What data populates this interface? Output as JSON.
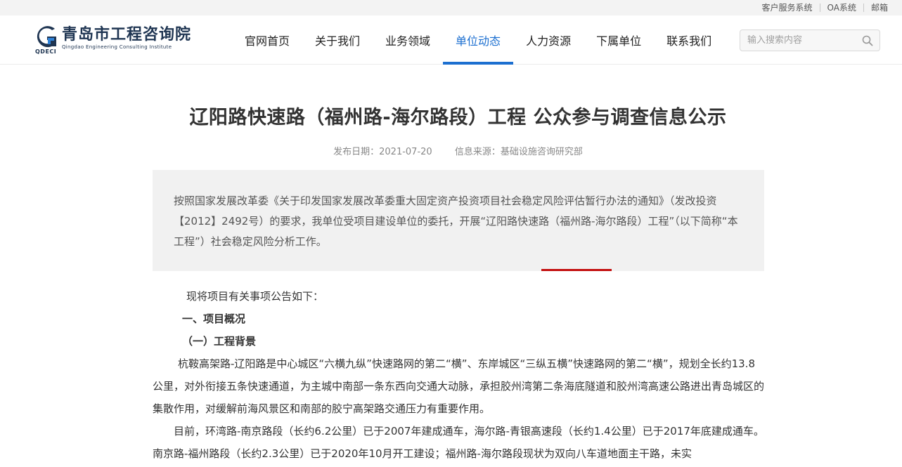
{
  "topbar": {
    "links": [
      "客户服务系统",
      "OA系统",
      "邮箱"
    ]
  },
  "logo": {
    "cn": "青岛市工程咨询院",
    "en": "Qingdao Engineering Consulting Institute",
    "abbr": "QDECI"
  },
  "nav": {
    "items": [
      "官网首页",
      "关于我们",
      "业务领域",
      "单位动态",
      "人力资源",
      "下属单位",
      "联系我们"
    ],
    "active": "单位动态"
  },
  "search": {
    "placeholder": "输入搜索内容",
    "icon": "search-icon"
  },
  "article": {
    "title": "辽阳路快速路（福州路-海尔路段）工程 公众参与调查信息公示",
    "date": "发布日期：2021-07-20",
    "source": "信息来源：基础设施咨询研究部",
    "summary": "按照国家发展改革委《关于印发国家发展改革委重大固定资产投资项目社会稳定风险评估暂行办法的通知》（发改投资【2012】2492号）的要求，我单位受项目建设单位的委托，开展“辽阳路快速路（福州路-海尔路段）工程”（以下简称“本工程”）社会稳定风险分析工作。",
    "intro": "现将项目有关事项公告如下：",
    "heading1": "一、项目概况",
    "heading2": "（一）工程背景",
    "para1": "杭鞍高架路-辽阳路是中心城区“六横九纵”快速路网的第二“横”、东岸城区“三纵五横”快速路网的第二“横”，规划全长约13.8公里，对外衔接五条快速通道，为主城中南部一条东西向交通大动脉，承担胶州湾第二条海底隧道和胶州湾高速公路进出青岛城区的集散作用，对缓解前海风景区和南部的胶宁高架路交通压力有重要作用。",
    "para2": "目前，环湾路-南京路段（长约6.2公里）已于2007年建成通车，海尔路-青银高速段（长约1.4公里）已于2017年底建成通车。南京路-福州路段（长约2.3公里）已于2020年10月开工建设；福州路-海尔路段现状为双向八车道地面主干路，未实"
  },
  "colors": {
    "accent": "#1c6fd0",
    "highlight": "#c30d0d",
    "summary_bg": "#f1f1f1"
  }
}
